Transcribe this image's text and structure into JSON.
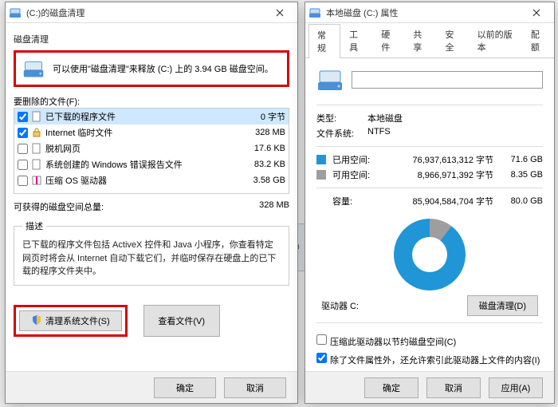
{
  "dc": {
    "title": "(C:)的磁盘清理",
    "section_title": "磁盘清理",
    "summary": "可以使用\"磁盘清理\"来释放  (C:) 上的 3.94 GB 磁盘空间。",
    "files_label": "要删除的文件(F):",
    "rows": [
      {
        "checked": true,
        "icon": "page",
        "label": "已下载的程序文件",
        "size": "0 字节"
      },
      {
        "checked": true,
        "icon": "lock",
        "label": "Internet 临时文件",
        "size": "328 MB"
      },
      {
        "checked": false,
        "icon": "page",
        "label": "脱机网页",
        "size": "17.6 KB"
      },
      {
        "checked": false,
        "icon": "page",
        "label": "系统创建的 Windows 错误报告文件",
        "size": "83.2 KB"
      },
      {
        "checked": false,
        "icon": "compress",
        "label": "压缩 OS 驱动器",
        "size": "3.58 GB"
      }
    ],
    "gain_label": "可获得的磁盘空间总量:",
    "gain_value": "328 MB",
    "desc_legend": "描述",
    "desc_text": "已下载的程序文件包括 ActiveX 控件和 Java 小程序，你查看特定网页时将会从 Internet 自动下载它们，并临时保存在硬盘上的已下载的程序文件夹中。",
    "clean_sys_label": "清理系统文件(S)",
    "view_files_label": "查看文件(V)",
    "ok": "确定",
    "cancel": "取消"
  },
  "pp": {
    "title": "本地磁盘 (C:) 属性",
    "tabs": [
      "常规",
      "工具",
      "硬件",
      "共享",
      "安全",
      "以前的版本",
      "配额"
    ],
    "label_value": "",
    "type_k": "类型:",
    "type_v": "本地磁盘",
    "fs_k": "文件系统:",
    "fs_v": "NTFS",
    "used_k": "已用空间:",
    "used_bytes": "76,937,613,312 字节",
    "used_h": "71.6 GB",
    "free_k": "可用空间:",
    "free_bytes": "8,966,971,392 字节",
    "free_h": "8.35 GB",
    "cap_k": "容量:",
    "cap_bytes": "85,904,584,704 字节",
    "cap_h": "80.0 GB",
    "drive_label": "驱动器 C:",
    "cleanup_btn": "磁盘清理(D)",
    "chk_compress": "压缩此驱动器以节约磁盘空间(C)",
    "chk_index": "除了文件属性外，还允许索引此驱动器上文件的内容(I)",
    "ok": "确定",
    "cancel": "取消",
    "apply": "应用(A)"
  },
  "behind": "0.0"
}
